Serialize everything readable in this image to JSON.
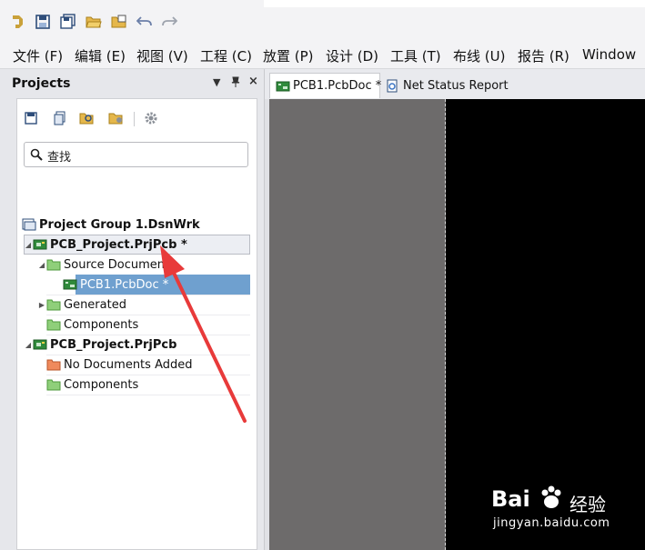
{
  "toolbar": {
    "icons": [
      "app-logo-icon",
      "save-icon",
      "save-all-icon",
      "open-folder-icon",
      "open-project-icon",
      "undo-icon",
      "redo-icon"
    ]
  },
  "menu": {
    "items": [
      "文件 (F)",
      "编辑 (E)",
      "视图 (V)",
      "工程 (C)",
      "放置 (P)",
      "设计 (D)",
      "工具 (T)",
      "布线 (U)",
      "报告 (R)",
      "Window"
    ]
  },
  "projects_panel": {
    "title": "Projects",
    "search_placeholder": "查找",
    "tree": [
      {
        "label": "Project Group 1.DsnWrk",
        "bold": true
      },
      {
        "label": "PCB_Project.PrjPcb *",
        "bold": true
      },
      {
        "label": "Source Documents",
        "bold": false
      },
      {
        "label": "PCB1.PcbDoc *",
        "bold": false,
        "selected": true
      },
      {
        "label": "Generated",
        "bold": false
      },
      {
        "label": "Components",
        "bold": false
      },
      {
        "label": "PCB_Project.PrjPcb",
        "bold": true
      },
      {
        "label": "No Documents Added",
        "bold": false
      },
      {
        "label": "Components",
        "bold": false
      }
    ]
  },
  "tabs": [
    {
      "label": "PCB1.PcbDoc *",
      "active": true
    },
    {
      "label": "Net Status Report",
      "active": false
    }
  ],
  "watermark": {
    "brand": "Bai",
    "brand_suffix": "经验",
    "url": "jingyan.baidu.com"
  },
  "colors": {
    "selection": "#6fa0cf",
    "annotation_arrow": "#e83a3a",
    "canvas_gray": "#6d6b6b",
    "canvas_black": "#000000"
  }
}
